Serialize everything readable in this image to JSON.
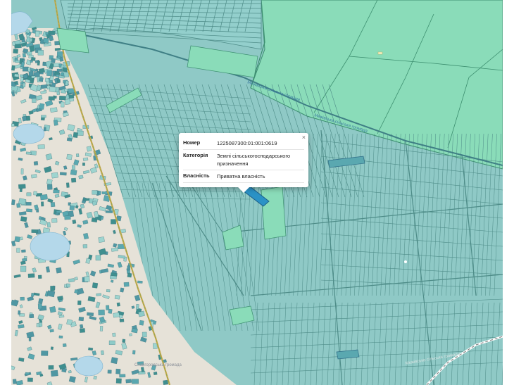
{
  "map": {
    "colors": {
      "base": "#8fc9c6",
      "parcel": "#8ecbc8",
      "parcel_stroke": "#4e8c88",
      "parcel_dark": "#5aa8b0",
      "forest": "#8adcb9",
      "forest_stroke": "#3c8e6f",
      "highlight": "#2b92c6",
      "village_ground": "#e6e2d8",
      "water": "#b4d8ea",
      "road": "#c8a84b"
    },
    "labels": {
      "boundary_top": "Межівська сільська громада",
      "boundary_right": "Межівська сільська громада",
      "village_area": "Славгородська громада",
      "diagonal_road": "Межівська сільська громада"
    }
  },
  "popup": {
    "close_glyph": "×",
    "rows": [
      {
        "key": "Номер",
        "value": "1225087300:01:001:0619"
      },
      {
        "key": "Категорія",
        "value": "Землі сільськогосподарського призначення"
      },
      {
        "key": "Власність",
        "value": "Приватна власність"
      }
    ]
  }
}
